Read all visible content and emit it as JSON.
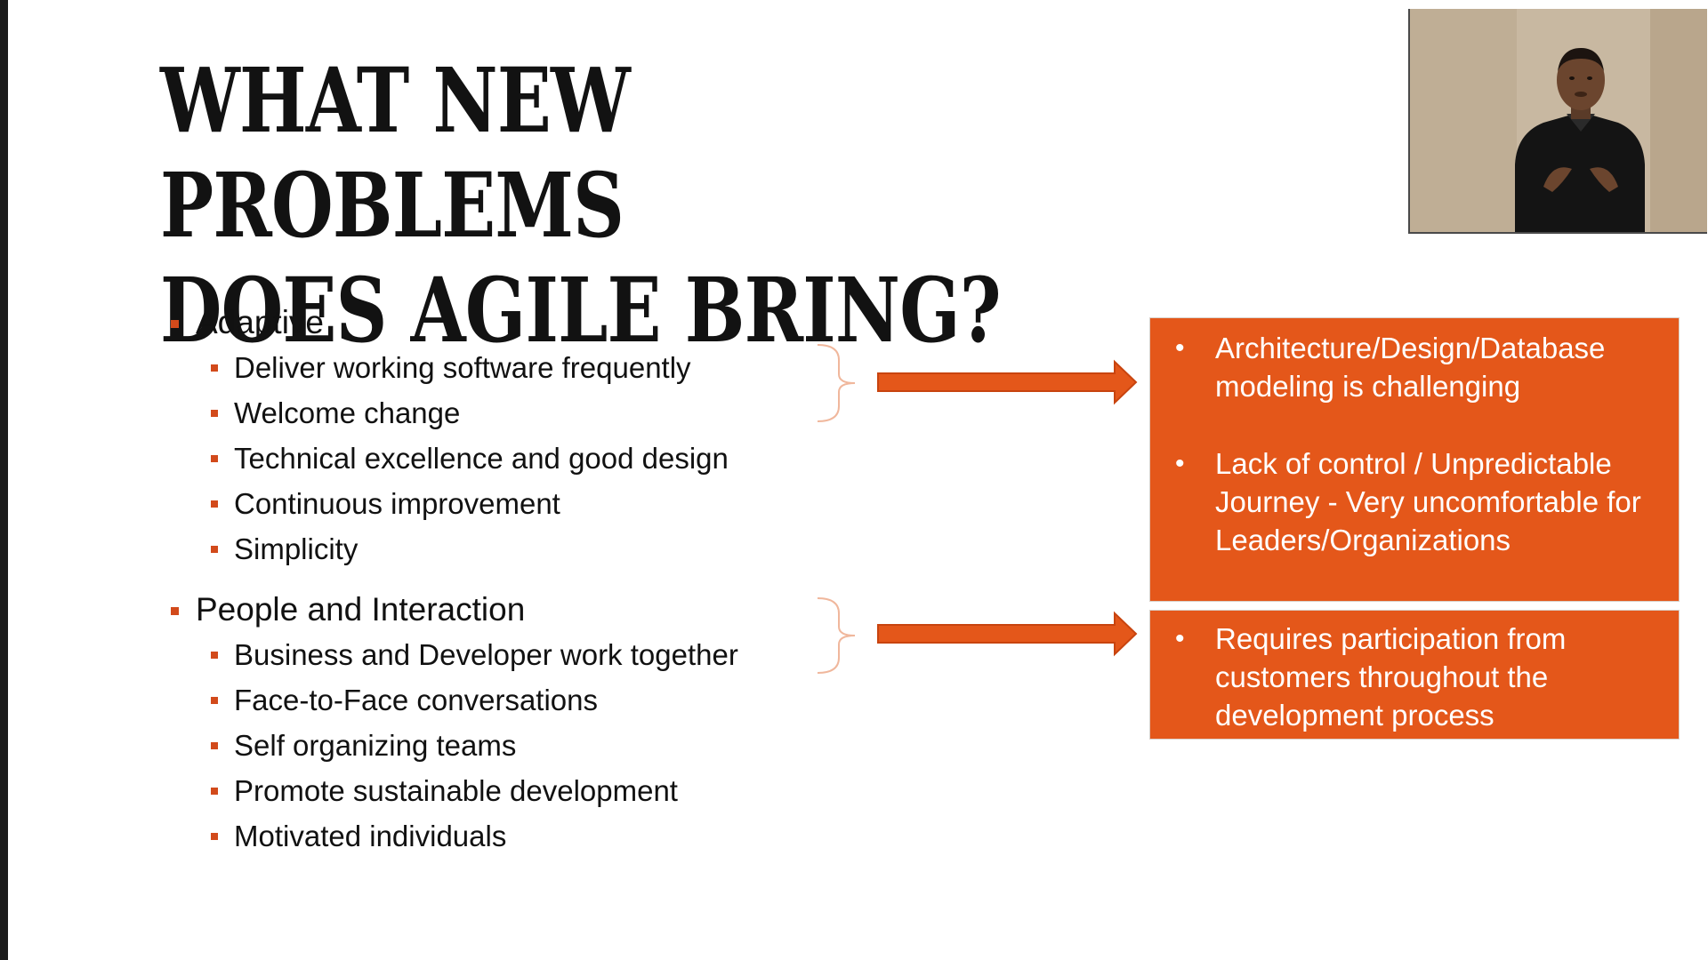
{
  "slide": {
    "title_lines": [
      "WHAT NEW PROBLEMS",
      "DOES AGILE BRING?"
    ],
    "groups": [
      {
        "heading": "Adaptive",
        "items": [
          "Deliver working software frequently",
          "Welcome change",
          "Technical excellence and good design",
          "Continuous improvement",
          "Simplicity"
        ]
      },
      {
        "heading": "People and Interaction",
        "items": [
          "Business and Developer work together",
          "Face-to-Face conversations",
          "Self organizing teams",
          "Promote sustainable development",
          "Motivated individuals"
        ]
      }
    ],
    "callouts": [
      {
        "items": [
          "Architecture/Design/Database modeling is challenging",
          "Lack of control / Unpredictable Journey - Very uncomfortable for Leaders/Organizations"
        ]
      },
      {
        "items": [
          "Requires participation from customers throughout the development process"
        ]
      }
    ]
  },
  "colors": {
    "accent": "#e4571a",
    "bullet": "#d24a1b",
    "brace": "#f0b79c",
    "title": "#121212",
    "background": "#ffffff"
  },
  "webcam": {
    "subject": "presenter-video"
  }
}
